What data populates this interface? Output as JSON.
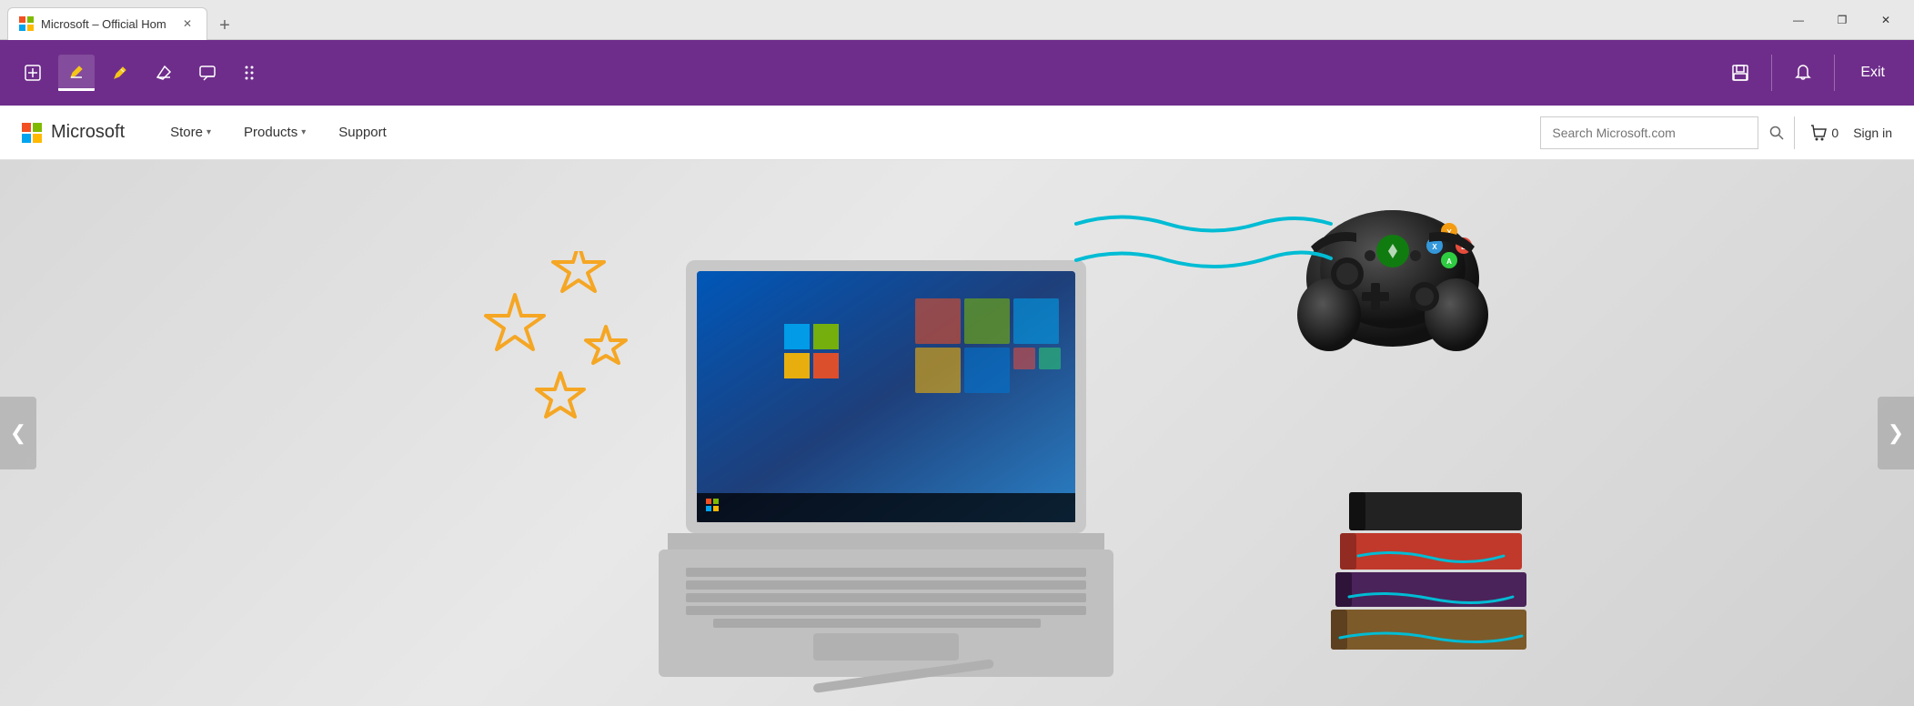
{
  "browser": {
    "tab_title": "Microsoft – Official Hom",
    "tab_favicon": "M",
    "new_tab_icon": "+",
    "window_minimize": "—",
    "window_restore": "❐",
    "window_close": "✕"
  },
  "toolbar": {
    "icons": [
      {
        "name": "annotate-icon",
        "symbol": "✎"
      },
      {
        "name": "highlight-icon",
        "symbol": "▼",
        "active": true
      },
      {
        "name": "filter-icon",
        "symbol": "▼"
      },
      {
        "name": "erase-icon",
        "symbol": "◇"
      },
      {
        "name": "comment-icon",
        "symbol": "💬"
      },
      {
        "name": "more-tools-icon",
        "symbol": "⁞⁞"
      }
    ],
    "right": [
      {
        "name": "save-icon",
        "symbol": "💾"
      },
      {
        "name": "bell-icon",
        "symbol": "🔔"
      }
    ],
    "exit_label": "Exit"
  },
  "nav": {
    "logo_text": "Microsoft",
    "store_label": "Store",
    "products_label": "Products",
    "support_label": "Support",
    "search_placeholder": "Search Microsoft.com",
    "cart_label": "0",
    "sign_in_label": "Sign in"
  },
  "hero": {
    "prev_arrow": "❮",
    "next_arrow": "❯"
  }
}
